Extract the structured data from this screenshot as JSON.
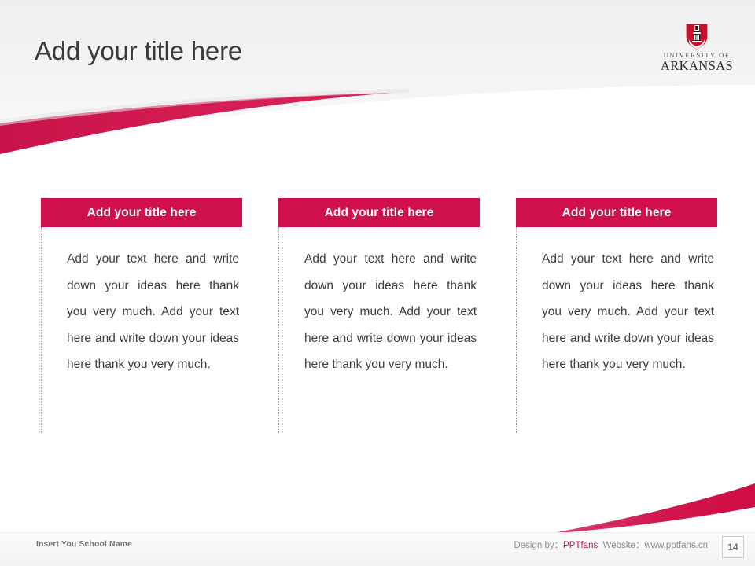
{
  "slide": {
    "title": "Add your title here",
    "accent_color": "#D0104C",
    "title_color": "#3b3b3b",
    "background_color": "#ffffff"
  },
  "logo": {
    "name": "university-of-arkansas-logo",
    "line1": "UNIVERSITY OF",
    "line2": "ARKANSAS",
    "shield_color": "#C8102E"
  },
  "columns": [
    {
      "header": "Add your title here",
      "body": "Add your text here and write down your ideas here thank you very much. Add your text here and write down your ideas here thank you very much."
    },
    {
      "header": "Add your title here",
      "body": "Add your text here and write down your ideas here thank you very much. Add your text here and write down your ideas here thank you very much."
    },
    {
      "header": "Add your title here",
      "body": "Add your text here and write down your ideas here thank you very much. Add your text here and write down your ideas here thank you very much."
    }
  ],
  "footer": {
    "school_name": "Insert You School Name",
    "design_by_label": "Design by：",
    "design_by_value": "PPTfans",
    "website_label": "Website：",
    "website_value": "www.pptfans.cn",
    "page_number": "14"
  }
}
